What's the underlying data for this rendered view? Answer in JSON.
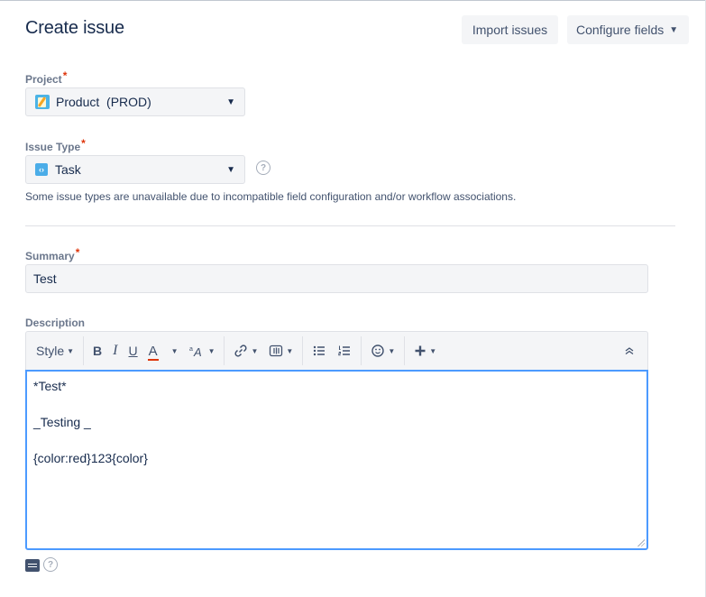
{
  "header": {
    "title": "Create issue",
    "import_label": "Import issues",
    "configure_label": "Configure fields"
  },
  "project": {
    "label": "Project",
    "required_mark": "*",
    "value": "Product  (PROD)"
  },
  "issue_type": {
    "label": "Issue Type",
    "required_mark": "*",
    "value": "Task",
    "help_glyph": "?",
    "note": "Some issue types are unavailable due to incompatible field configuration and/or workflow associations."
  },
  "summary": {
    "label": "Summary",
    "required_mark": "*",
    "value": "Test"
  },
  "description": {
    "label": "Description",
    "toolbar": {
      "style_label": "Style",
      "bold_label": "B",
      "italic_label": "I",
      "underline_label": "U",
      "text_color_label": "A"
    },
    "lines": [
      "*Test*",
      "",
      "_Testing _",
      "",
      "{color:red}123{color}"
    ]
  },
  "footer": {
    "help_glyph": "?"
  },
  "colors": {
    "accent_focus": "#4c9aff",
    "required": "#de350b",
    "text_color_bar": "#de350b"
  },
  "icons": [
    "product-project-icon",
    "task-type-icon",
    "help-icon",
    "chevron-down-icon",
    "link-icon",
    "attachment-icon",
    "bullet-list-icon",
    "numbered-list-icon",
    "emoji-icon",
    "plus-icon",
    "collapse-icon",
    "text-mode-icon"
  ]
}
